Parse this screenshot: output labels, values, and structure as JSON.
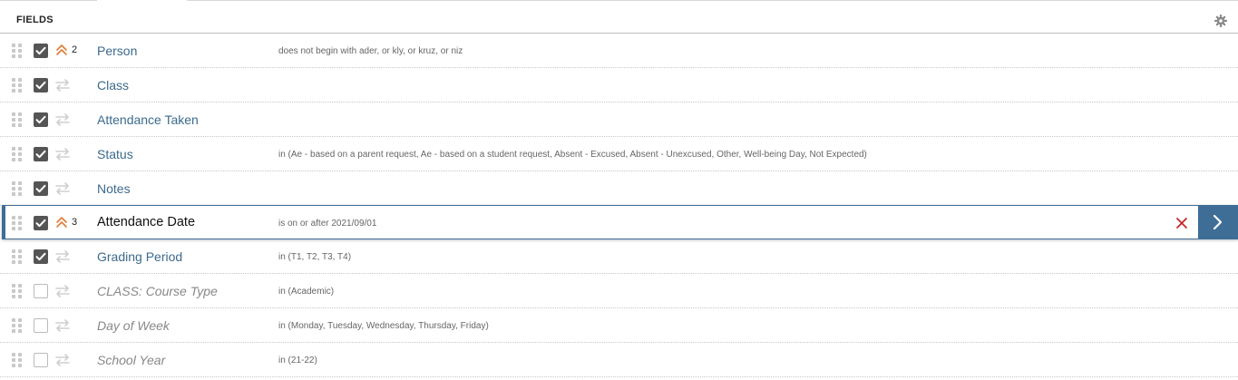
{
  "header": {
    "title": "FIELDS",
    "settings_icon": "gear-icon"
  },
  "colors": {
    "link_blue": "#3c6a8c",
    "selected_border": "#3e6d96",
    "sort_orange": "#e07b39",
    "remove_red": "#c62828"
  },
  "fields": [
    {
      "label": "Person",
      "enabled": true,
      "sort_order": "2",
      "criteria": "does not begin with ader, or kly, or kruz, or niz",
      "selected": false
    },
    {
      "label": "Class",
      "enabled": true,
      "sort_order": "",
      "criteria": "",
      "selected": false
    },
    {
      "label": "Attendance Taken",
      "enabled": true,
      "sort_order": "",
      "criteria": "",
      "selected": false
    },
    {
      "label": "Status",
      "enabled": true,
      "sort_order": "",
      "criteria": "in (Ae - based on a parent request, Ae - based on a student request, Absent - Excused, Absent - Unexcused, Other, Well-being Day, Not Expected)",
      "selected": false
    },
    {
      "label": "Notes",
      "enabled": true,
      "sort_order": "",
      "criteria": "",
      "selected": false
    },
    {
      "label": "Attendance Date",
      "enabled": true,
      "sort_order": "3",
      "criteria": "is on or after 2021/09/01",
      "selected": true
    },
    {
      "label": "Grading Period",
      "enabled": true,
      "sort_order": "",
      "criteria": "in (T1, T2, T3, T4)",
      "selected": false
    },
    {
      "label": "CLASS: Course Type",
      "enabled": false,
      "sort_order": "",
      "criteria": "in (Academic)",
      "selected": false
    },
    {
      "label": "Day of Week",
      "enabled": false,
      "sort_order": "",
      "criteria": "in (Monday, Tuesday, Wednesday, Thursday, Friday)",
      "selected": false
    },
    {
      "label": "School Year",
      "enabled": false,
      "sort_order": "",
      "criteria": "in (21-22)",
      "selected": false
    }
  ]
}
